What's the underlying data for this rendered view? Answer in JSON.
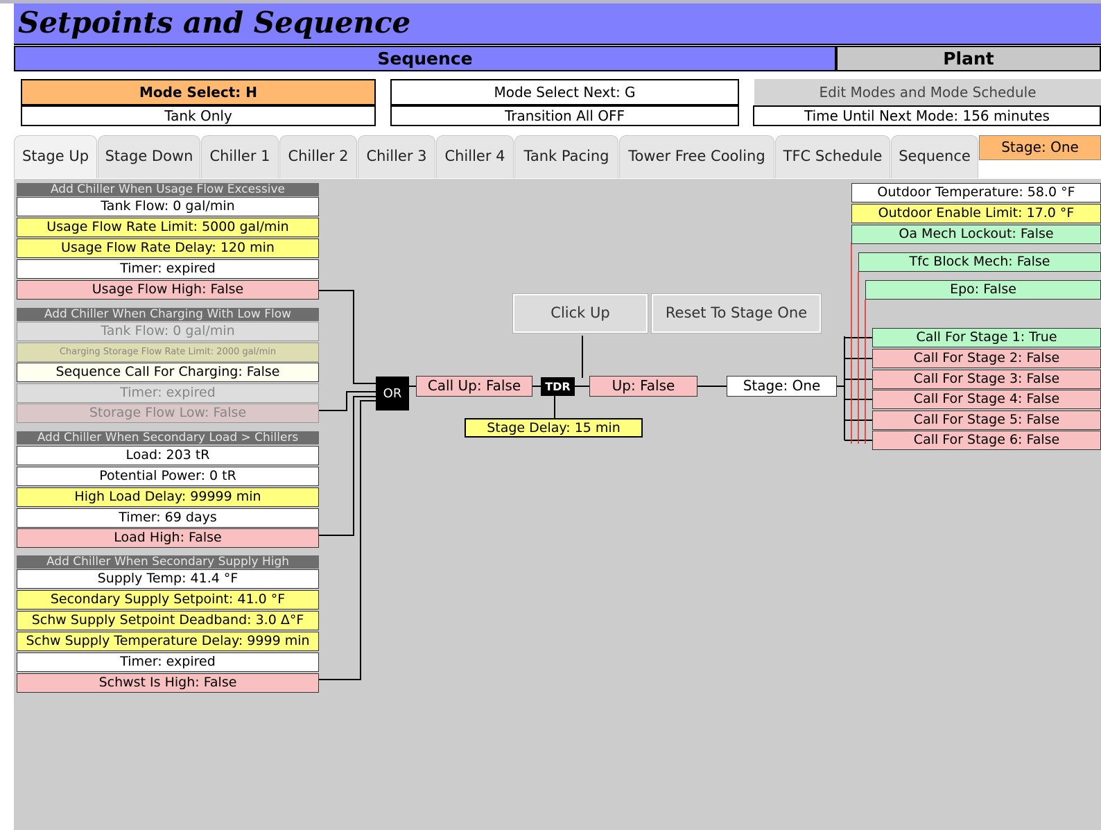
{
  "title": "Setpoints and Sequence",
  "header": {
    "sequence": "Sequence",
    "plant": "Plant"
  },
  "mode": {
    "select": "Mode Select: H",
    "select_sub": "Tank Only",
    "next": "Mode Select Next: G",
    "next_sub": "Transition All OFF",
    "edit": "Edit Modes and Mode Schedule",
    "time_until": "Time Until Next Mode: 156 minutes"
  },
  "tabs": [
    "Stage Up",
    "Stage Down",
    "Chiller 1",
    "Chiller 2",
    "Chiller 3",
    "Chiller 4",
    "Tank Pacing",
    "Tower Free Cooling",
    "TFC Schedule",
    "Sequence"
  ],
  "stage_badge": "Stage: One",
  "group1": {
    "title": "Add Chiller When Usage Flow Excessive",
    "tank_flow": "Tank Flow: 0 gal/min",
    "limit": "Usage Flow Rate Limit: 5000 gal/min",
    "delay": "Usage Flow Rate Delay: 120 min",
    "timer": "Timer: expired",
    "result": "Usage Flow High: False"
  },
  "group2": {
    "title": "Add Chiller When Charging With Low Flow",
    "tank_flow": "Tank Flow: 0 gal/min",
    "limit": "Charging Storage Flow Rate Limit: 2000 gal/min",
    "call": "Sequence Call For Charging: False",
    "timer": "Timer: expired",
    "result": "Storage Flow Low: False"
  },
  "group3": {
    "title": "Add Chiller When Secondary Load > Chillers",
    "load": "Load: 203 tR",
    "power": "Potential Power: 0 tR",
    "delay": "High Load Delay: 99999 min",
    "timer": "Timer: 69 days",
    "result": "Load High: False"
  },
  "group4": {
    "title": "Add Chiller When Secondary Supply High",
    "supply": "Supply Temp: 41.4 °F",
    "setpoint": "Secondary Supply Setpoint: 41.0 °F",
    "deadband": "Schw Supply Setpoint Deadband: 3.0 Δ°F",
    "delay": "Schw Supply Temperature Delay: 9999 min",
    "timer": "Timer: expired",
    "result": "Schwst Is High: False"
  },
  "logic": {
    "or": "OR",
    "call_up": "Call Up: False",
    "tdr": "TDR",
    "up": "Up: False",
    "stage": "Stage: One",
    "stage_delay": "Stage Delay: 15 min",
    "click_up": "Click Up",
    "reset": "Reset To Stage One"
  },
  "right": {
    "oat": "Outdoor Temperature: 58.0 °F",
    "enable": "Outdoor Enable Limit: 17.0 °F",
    "lockout": "Oa Mech Lockout: False",
    "tfc": "Tfc Block Mech: False",
    "epo": "Epo: False",
    "calls": [
      "Call For Stage 1: True",
      "Call For Stage 2: False",
      "Call For Stage 3: False",
      "Call For Stage 4: False",
      "Call For Stage 5: False",
      "Call For Stage 6: False"
    ]
  },
  "colors": {
    "accent": "#8080ff",
    "true": "#b8f8c8",
    "false": "#f8c0c0",
    "setpoint": "#ffff80",
    "highlight": "#ffb870"
  }
}
